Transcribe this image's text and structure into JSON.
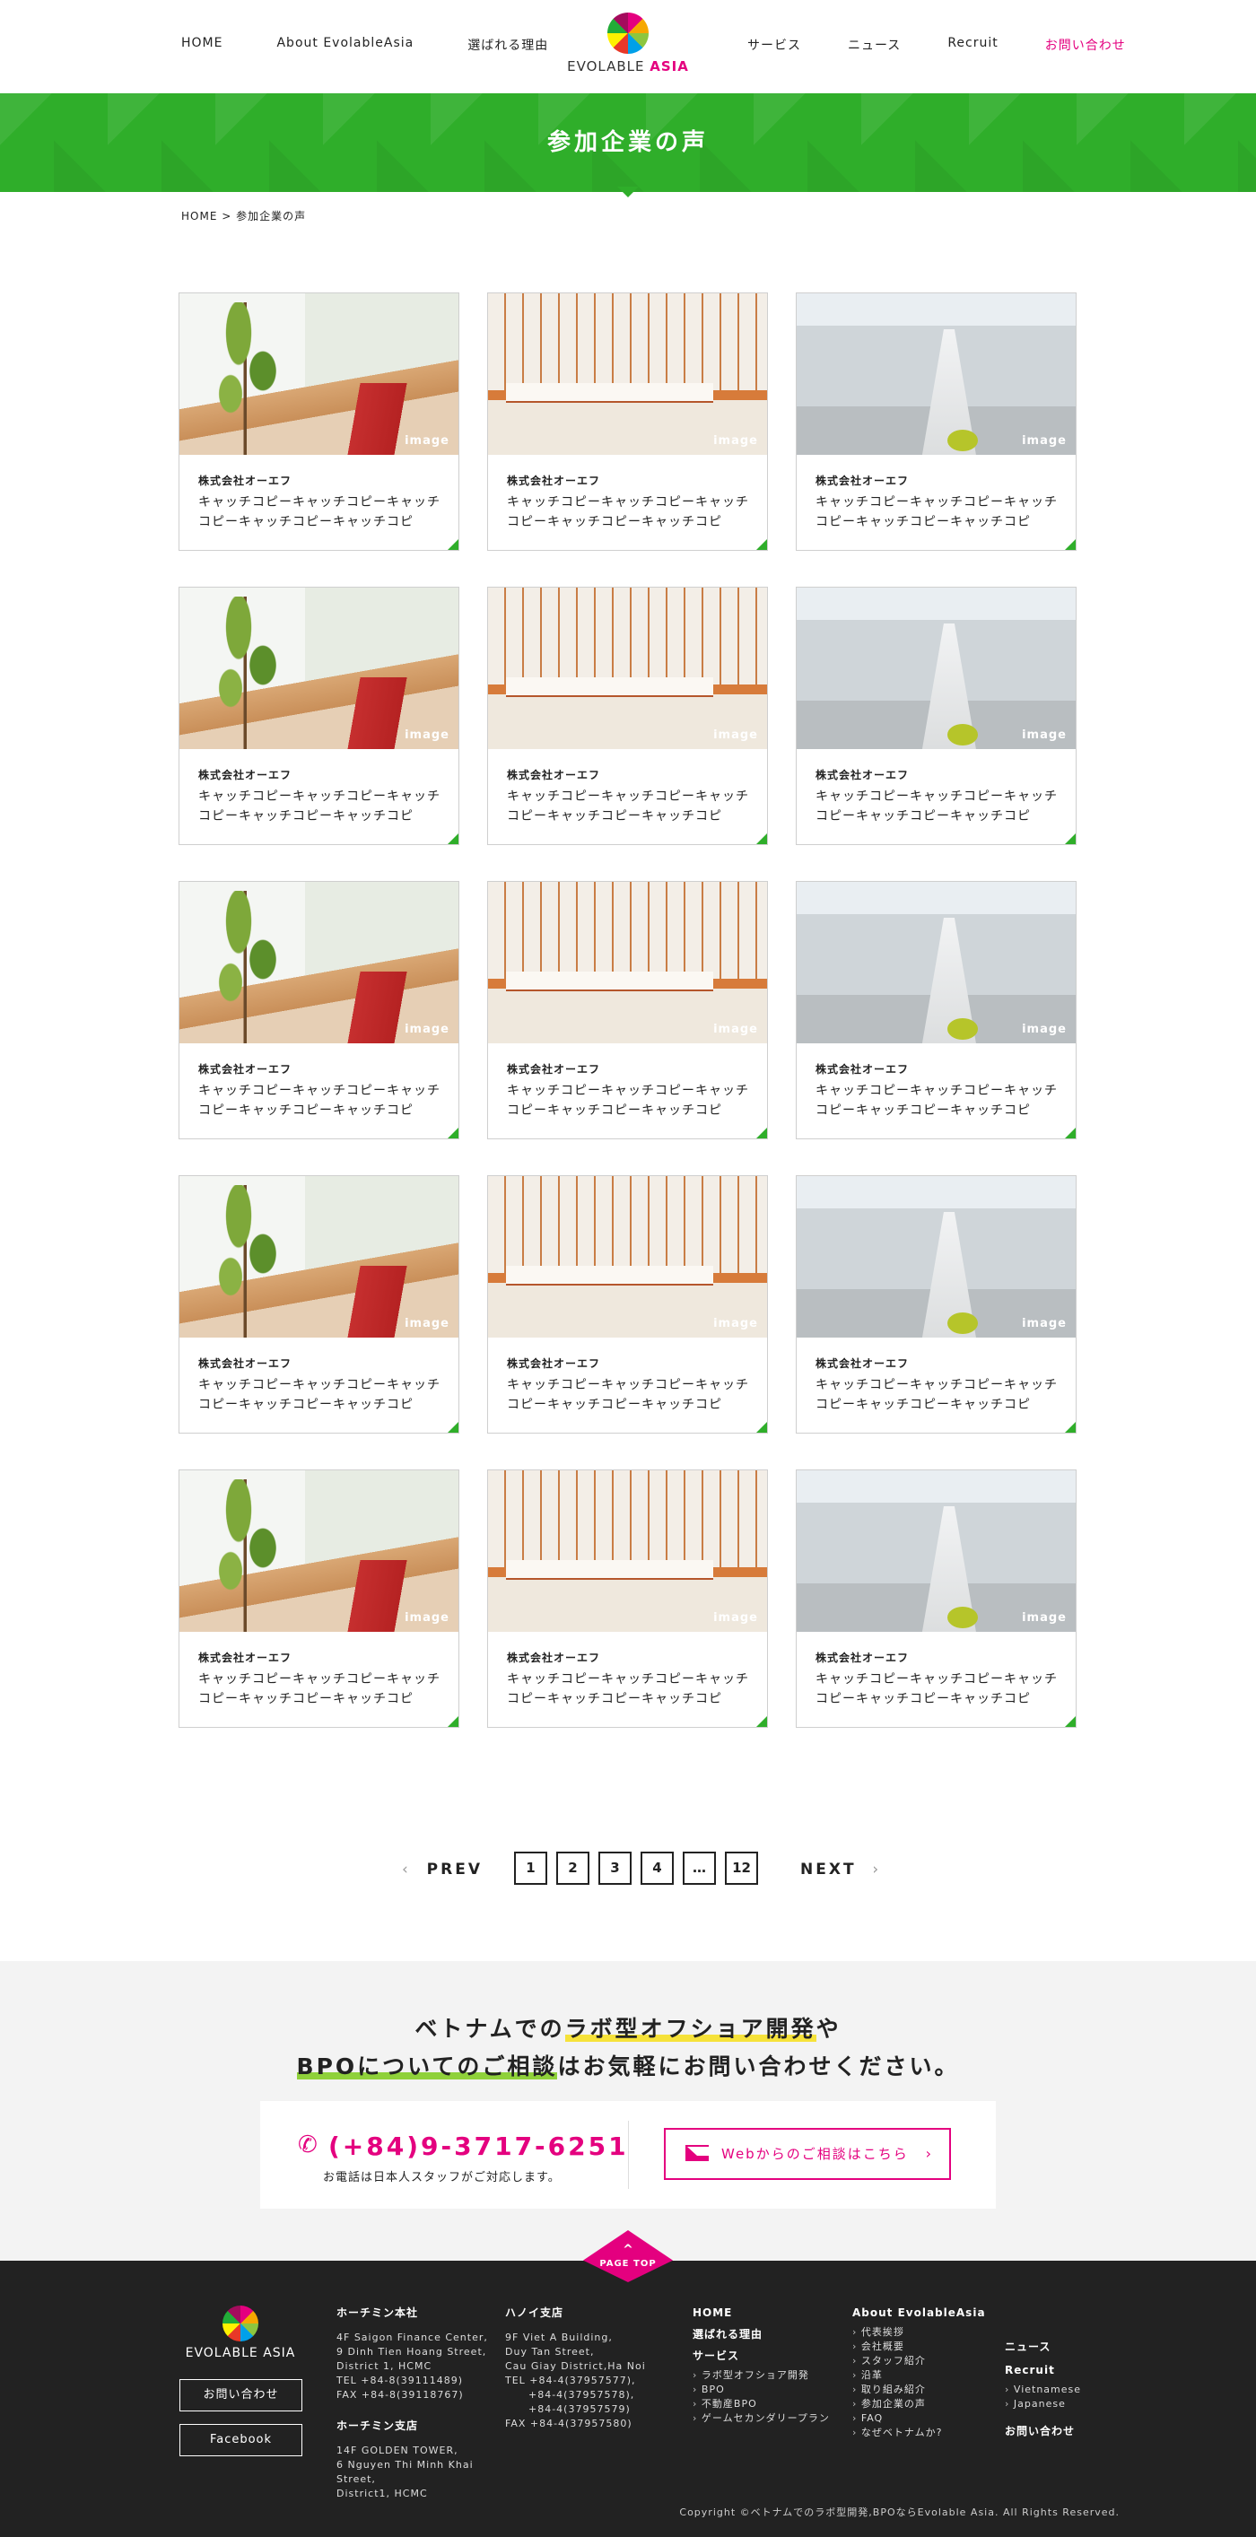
{
  "header": {
    "nav_left": [
      "HOME",
      "About EvolableAsia",
      "選ばれる理由"
    ],
    "nav_right": [
      "サービス",
      "ニュース",
      "Recruit"
    ],
    "nav_contact": "お問い合わせ",
    "logo_text_main": "EVOLABLE",
    "logo_text_accent": "ASIA"
  },
  "banner": {
    "title": "参加企業の声"
  },
  "breadcrumb": {
    "home": "HOME",
    "sep": ">",
    "current": "参加企業の声"
  },
  "cards": [
    {
      "image": "image",
      "company": "株式会社オーエフ",
      "copy": "キャッチコピーキャッチコピーキャッチコピーキャッチコピーキャッチコピ",
      "photo": "a"
    },
    {
      "image": "image",
      "company": "株式会社オーエフ",
      "copy": "キャッチコピーキャッチコピーキャッチコピーキャッチコピーキャッチコピ",
      "photo": "b"
    },
    {
      "image": "image",
      "company": "株式会社オーエフ",
      "copy": "キャッチコピーキャッチコピーキャッチコピーキャッチコピーキャッチコピ",
      "photo": "c"
    },
    {
      "image": "image",
      "company": "株式会社オーエフ",
      "copy": "キャッチコピーキャッチコピーキャッチコピーキャッチコピーキャッチコピ",
      "photo": "a"
    },
    {
      "image": "image",
      "company": "株式会社オーエフ",
      "copy": "キャッチコピーキャッチコピーキャッチコピーキャッチコピーキャッチコピ",
      "photo": "b"
    },
    {
      "image": "image",
      "company": "株式会社オーエフ",
      "copy": "キャッチコピーキャッチコピーキャッチコピーキャッチコピーキャッチコピ",
      "photo": "c"
    },
    {
      "image": "image",
      "company": "株式会社オーエフ",
      "copy": "キャッチコピーキャッチコピーキャッチコピーキャッチコピーキャッチコピ",
      "photo": "a"
    },
    {
      "image": "image",
      "company": "株式会社オーエフ",
      "copy": "キャッチコピーキャッチコピーキャッチコピーキャッチコピーキャッチコピ",
      "photo": "b"
    },
    {
      "image": "image",
      "company": "株式会社オーエフ",
      "copy": "キャッチコピーキャッチコピーキャッチコピーキャッチコピーキャッチコピ",
      "photo": "c"
    },
    {
      "image": "image",
      "company": "株式会社オーエフ",
      "copy": "キャッチコピーキャッチコピーキャッチコピーキャッチコピーキャッチコピ",
      "photo": "a"
    },
    {
      "image": "image",
      "company": "株式会社オーエフ",
      "copy": "キャッチコピーキャッチコピーキャッチコピーキャッチコピーキャッチコピ",
      "photo": "b"
    },
    {
      "image": "image",
      "company": "株式会社オーエフ",
      "copy": "キャッチコピーキャッチコピーキャッチコピーキャッチコピーキャッチコピ",
      "photo": "c"
    },
    {
      "image": "image",
      "company": "株式会社オーエフ",
      "copy": "キャッチコピーキャッチコピーキャッチコピーキャッチコピーキャッチコピ",
      "photo": "a"
    },
    {
      "image": "image",
      "company": "株式会社オーエフ",
      "copy": "キャッチコピーキャッチコピーキャッチコピーキャッチコピーキャッチコピ",
      "photo": "b"
    },
    {
      "image": "image",
      "company": "株式会社オーエフ",
      "copy": "キャッチコピーキャッチコピーキャッチコピーキャッチコピーキャッチコピ",
      "photo": "c"
    }
  ],
  "pagination": {
    "prev": "PREV",
    "next": "NEXT",
    "pages": [
      "1",
      "2",
      "3",
      "4",
      "…",
      "12"
    ]
  },
  "contact": {
    "line1_pre": "ベトナムでの",
    "line1_hl": "ラボ型オフショア開発",
    "line1_post": "や",
    "line2_hl": "BPOについてのご相談",
    "line2_post": "はお気軽にお問い合わせください。",
    "phone": "(+84)9-3717-6251",
    "phone_note": "お電話は日本人スタッフがご対応します。",
    "web_button": "Webからのご相談はこちら"
  },
  "footer": {
    "page_top": "PAGE TOP",
    "logo_text": "EVOLABLE ASIA",
    "btn_contact": "お問い合わせ",
    "btn_facebook": "Facebook",
    "hcm_head": "ホーチミン本社",
    "hcm_lines": [
      "4F Saigon Finance Center,",
      "9 Dinh Tien Hoang Street,",
      "District 1, HCMC",
      "TEL +84-8(39111489)",
      "FAX +84-8(39118767)"
    ],
    "hcm2_head": "ホーチミン支店",
    "hcm2_lines": [
      "14F GOLDEN TOWER,",
      "6 Nguyen Thi Minh Khai Street,",
      "District1, HCMC"
    ],
    "hanoi_head": "ハノイ支店",
    "hanoi_lines": [
      "9F Viet A Building,",
      "Duy Tan Street,",
      "Cau Giay District,Ha Noi",
      "TEL +84-4(37957577),",
      "+84-4(37957578),",
      "+84-4(37957579)",
      "FAX +84-4(37957580)"
    ],
    "col3_home": "HOME",
    "col3_reason": "選ばれる理由",
    "col3_service": "サービス",
    "col3_items": [
      "ラボ型オフショア開発",
      "BPO",
      "不動産BPO",
      "ゲームセカンダリープラン"
    ],
    "col4_head": "About EvolableAsia",
    "col4_items": [
      "代表挨拶",
      "会社概要",
      "スタッフ紹介",
      "沿革",
      "取り組み紹介",
      "参加企業の声",
      "FAQ",
      "なぜベトナムか?"
    ],
    "col5_news": "ニュース",
    "col5_recruit": "Recruit",
    "col5_items": [
      "Vietnamese",
      "Japanese"
    ],
    "col5_contact": "お問い合わせ",
    "copyright": "Copyright ©ベトナムでのラボ型開発,BPOならEvolable Asia. All Rights Reserved."
  }
}
